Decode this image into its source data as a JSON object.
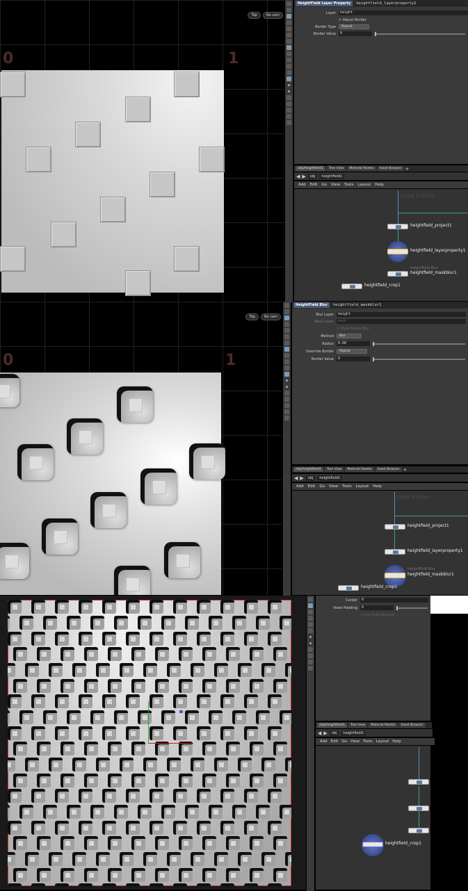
{
  "panel1": {
    "viewport": {
      "view_label": "Top",
      "cam_label": "No cam",
      "left_num": "0",
      "right_num": "1"
    },
    "params": {
      "node_type": "HeightField Layer Property",
      "node_name": "heightfield_layerproperty1",
      "layer_label": "Layer",
      "layer_value": "height",
      "adjust_border_label": "Adjust Border",
      "border_type_label": "Border Type",
      "border_type_value": "Repeat",
      "border_value_label": "Border Value",
      "border_value_value": "0"
    },
    "tabs": [
      "/obj/heightfield1",
      "Tree View",
      "Material Palette",
      "Asset Browser"
    ],
    "path_obj": "obj",
    "path_node": "heightfield1",
    "menu": [
      "Add",
      "Edit",
      "Go",
      "View",
      "Tools",
      "Layout",
      "Help"
    ],
    "watermark": "Indie Edition",
    "nodes": {
      "project": "heightfield_project1",
      "layerproperty": "heightfield_layerproperty1",
      "blur_ghost": "HeightField Blur",
      "maskblur": "heightfield_maskblur1",
      "crop": "heightfield_crop1"
    }
  },
  "panel2": {
    "viewport": {
      "view_label": "Top",
      "cam_label": "No cam",
      "left_num": "0",
      "right_num": "1"
    },
    "params": {
      "node_type": "HeightField Blur",
      "node_name": "heightfield_maskblur1",
      "blur_layer_label": "Blur Layer",
      "blur_layer_value": "height",
      "mask_layer_label": "Mask Layer",
      "mask_layer_value": "mask",
      "mask_aware_label": "Mask Aware Blur",
      "method_label": "Method",
      "method_value": "Blur",
      "radius_label": "Radius",
      "radius_value": "0.08",
      "override_border_label": "Override Border",
      "override_border_value": "Repeat",
      "border_value_label": "Border Value",
      "border_value_value": "0"
    },
    "tabs": [
      "/obj/heightfield1",
      "Tree View",
      "Material Palette",
      "Asset Browser"
    ],
    "path_obj": "obj",
    "path_node": "heightfield1",
    "menu": [
      "Add",
      "Edit",
      "Go",
      "View",
      "Tools",
      "Layout",
      "Help"
    ],
    "watermark": "Indie Edition",
    "nodes": {
      "project": "heightfield_project1",
      "layerproperty": "heightfield_layerproperty1",
      "blur_ghost": "HeightField Blur",
      "maskblur": "heightfield_maskblur1",
      "crop": "heightfield_crop1"
    }
  },
  "panel3": {
    "params": {
      "center_label": "Center",
      "center_value": "0",
      "voxel_padding_label": "Voxel Padding",
      "voxel_padding_value": "0",
      "use_point_bounds_label": "Use Point Bounds"
    },
    "tabs": [
      "/obj/heightfield1",
      "Tree View",
      "Material Palette",
      "Asset Browser"
    ],
    "path_obj": "obj",
    "path_node": "heightfield1",
    "menu": [
      "Add",
      "Edit",
      "Go",
      "View",
      "Tools",
      "Layout",
      "Help"
    ],
    "nodes": {
      "crop": "heightfield_crop1"
    }
  }
}
